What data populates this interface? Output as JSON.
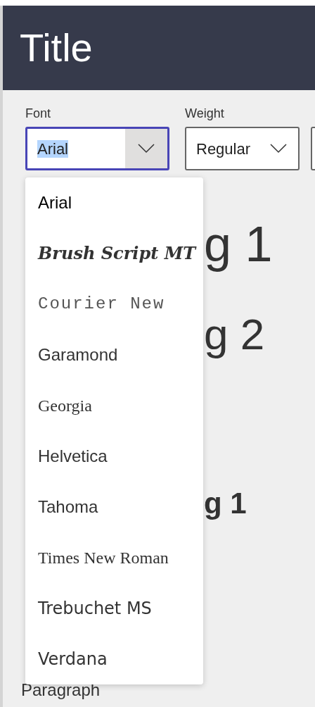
{
  "header": {
    "title": "Title"
  },
  "controls": [
    {
      "label": "Font",
      "value": "Arial",
      "focused": true,
      "value_highlighted": true
    },
    {
      "label": "Weight",
      "value": "Regular",
      "focused": false,
      "value_highlighted": false
    }
  ],
  "font_menu": {
    "items": [
      {
        "label": "Arial",
        "kind": "sans",
        "selected": true
      },
      {
        "label": "Brush Script MT",
        "kind": "script",
        "selected": false
      },
      {
        "label": "Courier New",
        "kind": "mono",
        "selected": false
      },
      {
        "label": "Garamond",
        "kind": "sans",
        "selected": false
      },
      {
        "label": "Georgia",
        "kind": "serif",
        "selected": false
      },
      {
        "label": "Helvetica",
        "kind": "sans",
        "selected": false
      },
      {
        "label": "Tahoma",
        "kind": "sans",
        "selected": false
      },
      {
        "label": "Times New Roman",
        "kind": "serif",
        "selected": false
      },
      {
        "label": "Trebuchet MS",
        "kind": "dejavu",
        "selected": false
      },
      {
        "label": "Verdana",
        "kind": "dejavu",
        "selected": false
      }
    ]
  },
  "preview": [
    {
      "kind": "h1",
      "text": "g 1"
    },
    {
      "kind": "h2",
      "text": "g 2"
    },
    {
      "kind": "h3"
    },
    {
      "kind": "sub1",
      "text": "g 1"
    },
    {
      "kind": "sub2"
    }
  ],
  "paragraph": "Paragraph"
}
